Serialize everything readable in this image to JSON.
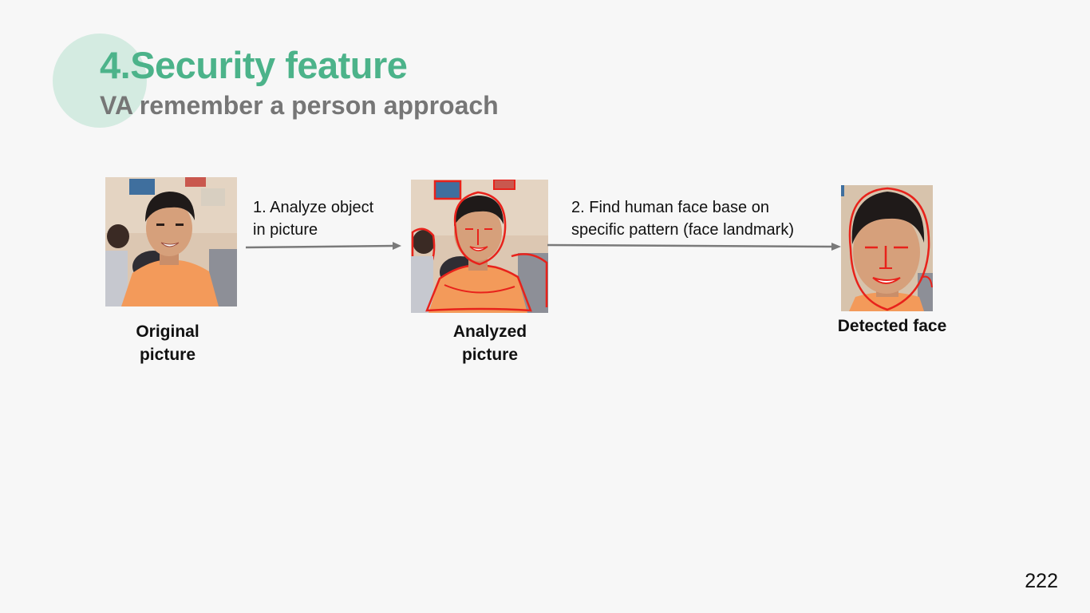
{
  "slide": {
    "title": "4.Security feature",
    "subtitle": "VA remember a person approach",
    "page_number": "222"
  },
  "steps": [
    {
      "line1": "1. Analyze object",
      "line2": "in picture"
    },
    {
      "line1": "2. Find human face base on",
      "line2": "specific pattern (face landmark)"
    }
  ],
  "images": [
    {
      "line1": "Original",
      "line2": "picture"
    },
    {
      "line1": "Analyzed",
      "line2": "picture"
    },
    {
      "line1": "Detected face"
    }
  ],
  "colors": {
    "title": "#4cb38a",
    "subtitle": "#767676",
    "circle": "#d4ebe1",
    "outline": "#e8221b",
    "shirt": "#f39a5a",
    "arrow": "#7a7a7a"
  }
}
